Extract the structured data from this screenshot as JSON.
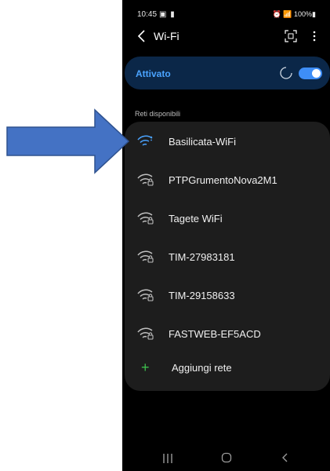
{
  "status_bar": {
    "time": "10:45",
    "left_icons": "▣ ▮",
    "right_text": "⏰ 📶 100%▮"
  },
  "app_bar": {
    "title": "Wi-Fi"
  },
  "wifi_toggle": {
    "label": "Attivato",
    "state": "on"
  },
  "available_networks": {
    "section_label": "Reti disponibili",
    "networks": [
      {
        "name": "Basilicata-WiFi",
        "secured": false,
        "connecting": true
      },
      {
        "name": "PTPGrumentoNova2M1",
        "secured": true,
        "connecting": false
      },
      {
        "name": "Tagete WiFi",
        "secured": true,
        "connecting": false
      },
      {
        "name": "TIM-27983181",
        "secured": true,
        "connecting": false
      },
      {
        "name": "TIM-29158633",
        "secured": true,
        "connecting": false
      },
      {
        "name": "FASTWEB-EF5ACD",
        "secured": true,
        "connecting": false
      }
    ],
    "add_network": {
      "label": "Aggiungi rete",
      "icon": "plus-icon"
    }
  },
  "nav_bar": {
    "icons": [
      "recent-apps-icon",
      "home-icon",
      "back-icon"
    ]
  },
  "annotation": {
    "icon": "right-arrow-icon",
    "color": "#4472c4"
  },
  "colors": {
    "accent": "#3e8ef7",
    "toggle_card": "#0b2748",
    "card": "#1d1d1d",
    "add_plus": "#3dbd4c"
  }
}
